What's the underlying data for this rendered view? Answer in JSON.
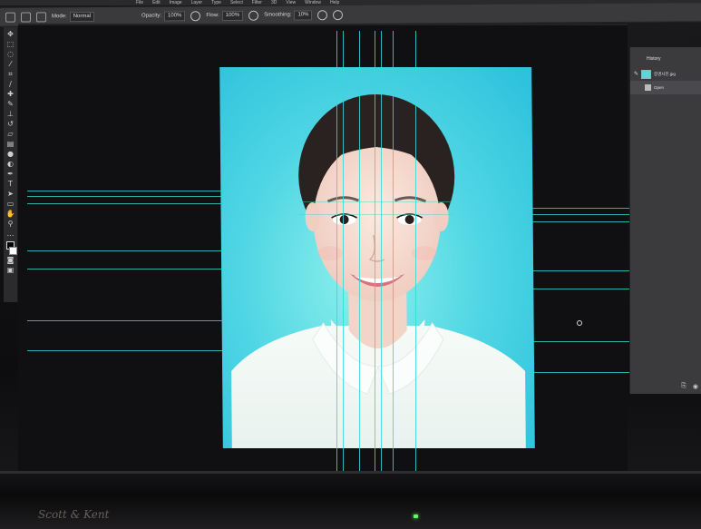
{
  "menu": [
    "File",
    "Edit",
    "Image",
    "Layer",
    "Type",
    "Select",
    "Filter",
    "3D",
    "View",
    "Window",
    "Help"
  ],
  "options_bar": {
    "mode_label": "Mode:",
    "mode_value": "Normal",
    "opacity_label": "Opacity:",
    "opacity_value": "100%",
    "flow_label": "Flow:",
    "flow_value": "100%",
    "smoothing_label": "Smoothing:",
    "smoothing_value": "10%"
  },
  "tools": [
    "move-icon",
    "marquee-icon",
    "lasso-icon",
    "magic-wand-icon",
    "crop-icon",
    "eyedropper-icon",
    "healing-icon",
    "brush-icon",
    "stamp-icon",
    "history-brush-icon",
    "eraser-icon",
    "gradient-icon",
    "blur-icon",
    "dodge-icon",
    "pen-icon",
    "type-icon",
    "path-select-icon",
    "shape-icon",
    "hand-icon",
    "zoom-icon"
  ],
  "history_panel": {
    "title": "History",
    "snapshot_label": "증명사진.jpg",
    "items": [
      "Open"
    ]
  },
  "brand": "Scott & Kent",
  "colors": {
    "guide": "#35d8d2",
    "photo_bg": "#4fd6e4",
    "ui_dark": "#3a3a3c"
  }
}
